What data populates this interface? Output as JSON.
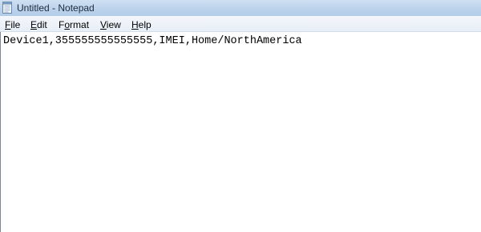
{
  "window": {
    "title": "Untitled - Notepad",
    "icon": "notepad-icon"
  },
  "menubar": {
    "items": [
      {
        "accel": "F",
        "rest": "ile"
      },
      {
        "accel": "E",
        "rest": "dit"
      },
      {
        "accel": "",
        "rest": "F",
        "accel2": "o",
        "rest2": "rmat"
      },
      {
        "accel": "V",
        "rest": "iew"
      },
      {
        "accel": "H",
        "rest": "elp"
      }
    ]
  },
  "editor": {
    "content": "Device1,355555555555555,IMEI,Home/NorthAmerica"
  }
}
